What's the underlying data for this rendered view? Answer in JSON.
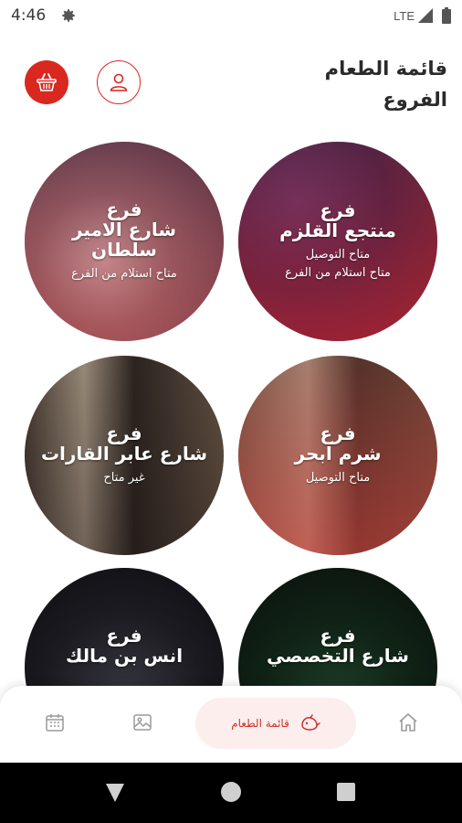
{
  "status_bar": {
    "time": "4:46",
    "network": "LTE",
    "icons": [
      "gear-icon",
      "signal-icon",
      "battery-icon"
    ]
  },
  "header": {
    "title_line1": "قائمة الطعام",
    "title_line2": "الفروع",
    "cart_icon": "basket-icon",
    "profile_icon": "user-icon",
    "accent": "#d9281f"
  },
  "branches": [
    {
      "label": "فرع",
      "name": "منتجع القلزم",
      "status": [
        "متاح التوصيل",
        "متاح استلام من الفرع"
      ]
    },
    {
      "label": "فرع",
      "name": "شارع الامير سلطان",
      "status": [
        "متاح استلام من الفرع"
      ]
    },
    {
      "label": "فرع",
      "name": "شرم ابحر",
      "status": [
        "متاح التوصيل"
      ]
    },
    {
      "label": "فرع",
      "name": "شارع عابر القارات",
      "status": [
        "غير متاح"
      ]
    },
    {
      "label": "فرع",
      "name": "شارع التخصصي",
      "status": []
    },
    {
      "label": "فرع",
      "name": "انس بن مالك",
      "status": []
    }
  ],
  "bottom_nav": {
    "active_label": "قائمة الطعام",
    "items": [
      "home-icon",
      "menu-icon",
      "gallery-icon",
      "calendar-icon"
    ]
  }
}
